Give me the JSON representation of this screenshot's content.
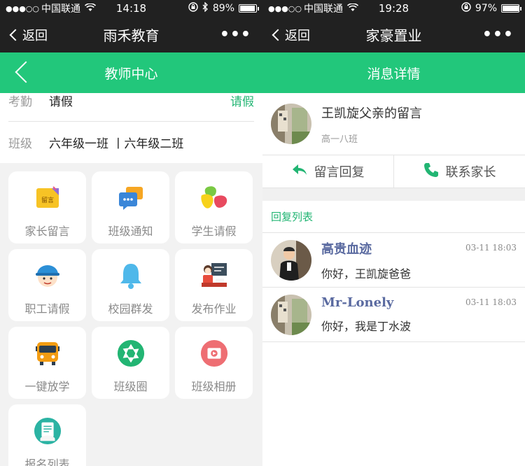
{
  "left": {
    "status": {
      "signal": "●●●○○",
      "carrier": "中国联通",
      "time": "14:18",
      "battery": "89%",
      "battery_level": 0.89
    },
    "nav": {
      "back_label": "返回",
      "title": "雨禾教育",
      "more": "•••"
    },
    "header": {
      "title": "教师中心"
    },
    "info": {
      "attendance_key": "考勤",
      "attendance_value": "请假",
      "attendance_action": "请假",
      "class_key": "班级",
      "class_value": "六年级一班 丨六年级二班"
    },
    "tiles": [
      {
        "label": "家长留言",
        "icon": "message-note-icon",
        "icon_text": "留言"
      },
      {
        "label": "班级通知",
        "icon": "chat-bubble-icon"
      },
      {
        "label": "学生请假",
        "icon": "tri-blob-icon"
      },
      {
        "label": "职工请假",
        "icon": "worker-face-icon"
      },
      {
        "label": "校园群发",
        "icon": "bell-icon"
      },
      {
        "label": "发布作业",
        "icon": "teacher-board-icon"
      },
      {
        "label": "一键放学",
        "icon": "school-bus-icon"
      },
      {
        "label": "班级圈",
        "icon": "aperture-icon"
      },
      {
        "label": "班级相册",
        "icon": "photo-album-icon"
      },
      {
        "label": "报名列表",
        "icon": "sign-up-icon"
      }
    ]
  },
  "right": {
    "status": {
      "signal": "●●●○○",
      "carrier": "中国联通",
      "time": "19:28",
      "battery": "97%",
      "battery_level": 0.97
    },
    "nav": {
      "back_label": "返回",
      "title": "家豪置业",
      "more": "•••"
    },
    "header": {
      "title": "消息详情"
    },
    "message": {
      "title": "王凯旋父亲的留言",
      "class": "高一八班"
    },
    "actions": {
      "reply": "留言回复",
      "contact": "联系家长"
    },
    "list_title": "回复列表",
    "replies": [
      {
        "name": "高贵血迹",
        "time": "03-11 18:03",
        "body": "你好，王凯旋爸爸"
      },
      {
        "name": "Mr-Lonely",
        "time": "03-11 18:03",
        "body": "你好，我是丁水波"
      }
    ]
  },
  "colors": {
    "accent": "#22c77b",
    "nav": "#212121",
    "link": "#22b573"
  }
}
